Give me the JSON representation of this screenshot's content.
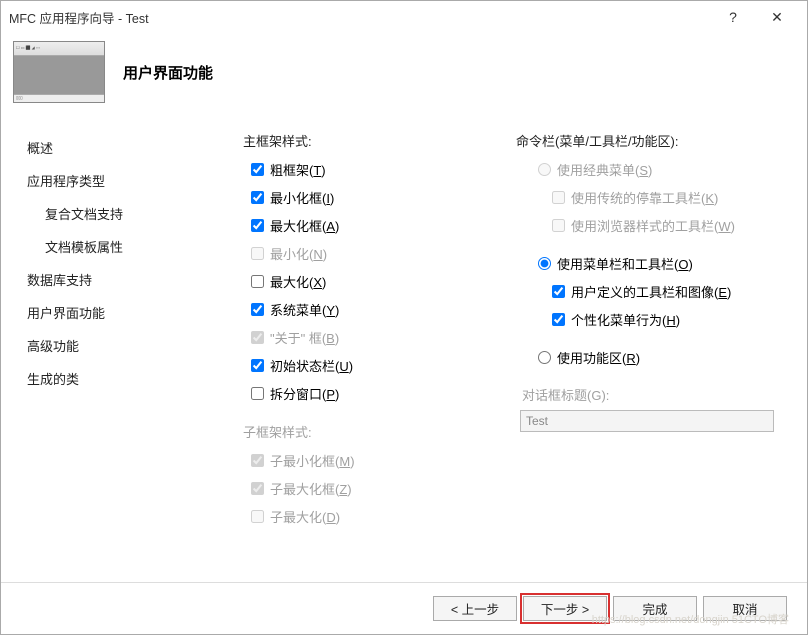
{
  "window": {
    "title": "MFC 应用程序向导 - Test"
  },
  "header": {
    "title": "用户界面功能"
  },
  "sidebar": {
    "items": [
      {
        "label": "概述"
      },
      {
        "label": "应用程序类型"
      },
      {
        "label": "复合文档支持",
        "indent": true
      },
      {
        "label": "文档模板属性",
        "indent": true
      },
      {
        "label": "数据库支持"
      },
      {
        "label": "用户界面功能",
        "current": true
      },
      {
        "label": "高级功能"
      },
      {
        "label": "生成的类"
      }
    ]
  },
  "left": {
    "main_frame_label": "主框架样式:",
    "checks": [
      {
        "label": "粗框架",
        "hot": "T",
        "checked": true
      },
      {
        "label": "最小化框",
        "hot": "I",
        "checked": true
      },
      {
        "label": "最大化框",
        "hot": "A",
        "checked": true
      },
      {
        "label": "最小化",
        "hot": "N",
        "checked": false,
        "disabled": true
      },
      {
        "label": "最大化",
        "hot": "X",
        "checked": false
      },
      {
        "label": "系统菜单",
        "hot": "Y",
        "checked": true
      },
      {
        "label": "\"关于\" 框",
        "hot": "B",
        "checked": true,
        "disabled": true
      },
      {
        "label": "初始状态栏",
        "hot": "U",
        "checked": true
      },
      {
        "label": "拆分窗口",
        "hot": "P",
        "checked": false
      }
    ],
    "child_frame_label": "子框架样式:",
    "child_checks": [
      {
        "label": "子最小化框",
        "hot": "M",
        "checked": true,
        "disabled": true
      },
      {
        "label": "子最大化框",
        "hot": "Z",
        "checked": true,
        "disabled": true
      },
      {
        "label": "子最大化",
        "hot": "D",
        "checked": false,
        "disabled": true
      }
    ]
  },
  "right": {
    "cmd_label": "命令栏(菜单/工具栏/功能区):",
    "radios": [
      {
        "label": "使用经典菜单",
        "hot": "S",
        "checked": false,
        "disabled": true,
        "indent": 1
      },
      {
        "label": "使用菜单栏和工具栏",
        "hot": "O",
        "checked": true,
        "indent": 1
      },
      {
        "label": "使用功能区",
        "hot": "R",
        "checked": false,
        "indent": 1
      }
    ],
    "sub_checks_classic": [
      {
        "label": "使用传统的停靠工具栏",
        "hot": "K",
        "checked": false,
        "disabled": true,
        "indent": 2
      },
      {
        "label": "使用浏览器样式的工具栏",
        "hot": "W",
        "checked": false,
        "disabled": true,
        "indent": 2
      }
    ],
    "sub_checks_menubar": [
      {
        "label": "用户定义的工具栏和图像",
        "hot": "E",
        "checked": true,
        "indent": 2
      },
      {
        "label": "个性化菜单行为",
        "hot": "H",
        "checked": true,
        "indent": 2
      }
    ],
    "dialog_title_label": "对话框标题(G):",
    "dialog_title_value": "Test"
  },
  "footer": {
    "prev": "< 上一步",
    "next": "下一步 >",
    "finish": "完成",
    "cancel": "取消"
  },
  "watermark": "https://blog.csdn.net/dongjin 51CTO博客"
}
